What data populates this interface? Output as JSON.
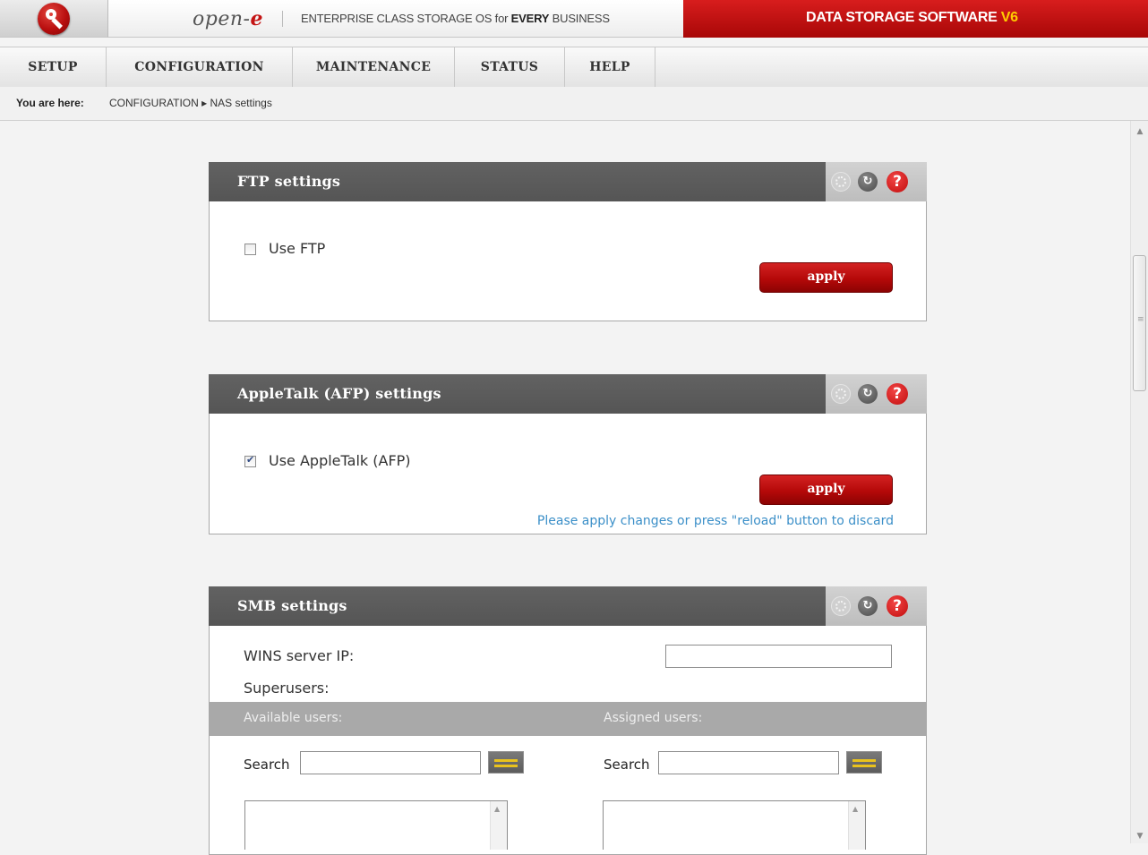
{
  "header": {
    "logo_icon": "key-icon",
    "brand_name_prefix": "open-",
    "brand_name_suffix": "e",
    "tagline_lead": "ENTERPRISE CLASS STORAGE OS for ",
    "tagline_bold": "EVERY",
    "tagline_tail": " BUSINESS",
    "product_title": "DATA STORAGE SOFTWARE ",
    "product_version": "V6",
    "colors": {
      "brand_red": "#c41414",
      "version_yellow": "#ffcc00"
    }
  },
  "nav": {
    "items": [
      {
        "label": "SETUP"
      },
      {
        "label": "CONFIGURATION"
      },
      {
        "label": "MAINTENANCE"
      },
      {
        "label": "STATUS"
      },
      {
        "label": "HELP"
      }
    ]
  },
  "breadcrumb": {
    "lead": "You are here:",
    "trail": "CONFIGURATION ▸ NAS settings"
  },
  "panels": {
    "ftp": {
      "title": "FTP settings",
      "checkbox_label": "Use FTP",
      "checked": false,
      "apply_label": "apply"
    },
    "afp": {
      "title": "AppleTalk (AFP) settings",
      "checkbox_label": "Use AppleTalk (AFP)",
      "checked": true,
      "apply_label": "apply",
      "notice": "Please apply changes or press \"reload\" button to discard"
    },
    "smb": {
      "title": "SMB settings",
      "wins_label": "WINS server IP:",
      "wins_value": "",
      "superusers_label": "Superusers:",
      "available_users_label": "Available users:",
      "assigned_users_label": "Assigned users:",
      "search_label": "Search",
      "search_available_value": "",
      "search_assigned_value": ""
    }
  },
  "panel_icons": {
    "loading": "loading-icon",
    "reload": "reload-icon",
    "reload_glyph": "↻",
    "help": "help-icon",
    "help_glyph": "?"
  },
  "colors": {
    "panel_header": "#5a5a5a",
    "apply_button": "#b50909",
    "notice_text": "#3b8fc8",
    "subheader": "#a9a9a9"
  }
}
